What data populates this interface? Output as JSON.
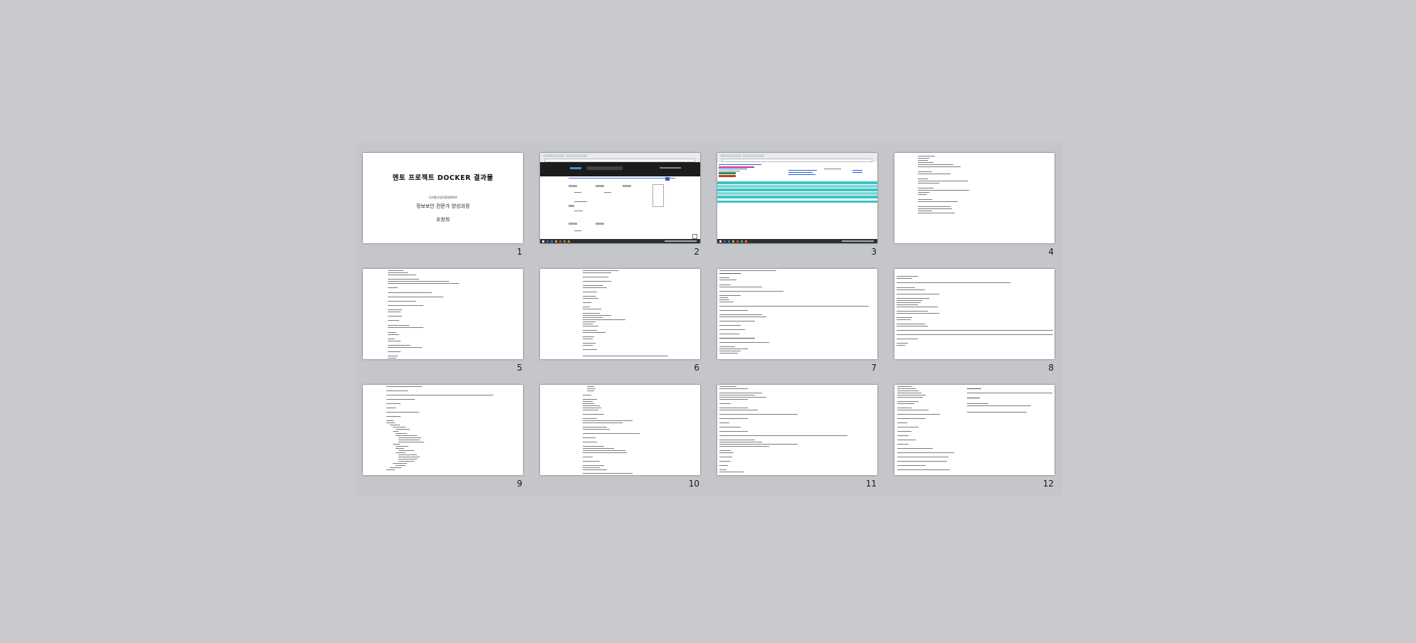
{
  "app": {
    "view": "slide-sorter",
    "background_color": "#c8cacd"
  },
  "slides": [
    {
      "number": "1",
      "kind": "title",
      "title": "멘토 프로젝트 DOCKER 결과물",
      "organization": "디지털산업진흥원/KISA",
      "course": "정보보안 전문가 양성과정",
      "author": "조창희"
    },
    {
      "number": "2",
      "kind": "screenshot-docker-hub"
    },
    {
      "number": "3",
      "kind": "screenshot-web-table"
    },
    {
      "number": "4",
      "kind": "text"
    },
    {
      "number": "5",
      "kind": "text"
    },
    {
      "number": "6",
      "kind": "text"
    },
    {
      "number": "7",
      "kind": "text"
    },
    {
      "number": "8",
      "kind": "text"
    },
    {
      "number": "9",
      "kind": "text"
    },
    {
      "number": "10",
      "kind": "text"
    },
    {
      "number": "11",
      "kind": "text"
    },
    {
      "number": "12",
      "kind": "text"
    }
  ]
}
